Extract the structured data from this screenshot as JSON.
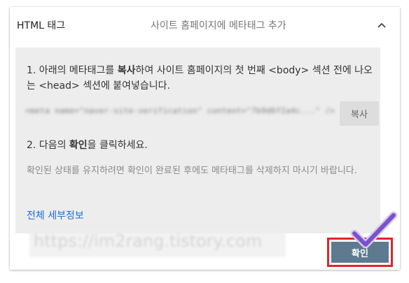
{
  "header": {
    "title": "HTML 태그",
    "subtitle": "사이트 홈페이지에 메타태그 추가"
  },
  "instructions": {
    "step1_prefix": "1. 아래의 메타태그를 ",
    "step1_bold": "복사",
    "step1_suffix": "하여 사이트 홈페이지의 첫 번째 <body> 섹션 전에 나오는 <head> 섹션에 붙여넣습니다.",
    "meta_code": "<meta name=\"naver-site-verification\" content=\"7b9d6f2a4c...\" />",
    "copy_button": "복사",
    "step2_prefix": "2. 다음의 ",
    "step2_bold": "확인",
    "step2_suffix": "을 클릭하세요.",
    "note": "확인된 상태를 유지하려면 확인이 완료된 후에도 메타태그를 삭제하지 마시기 바랍니다.",
    "details_link": "전체 세부정보"
  },
  "watermark": "https://im2rang.tistory.com",
  "confirm_button": "확인",
  "colors": {
    "panel_bg": "#ededed",
    "link": "#1a6fd6",
    "confirm_bg": "#5d7a8e",
    "highlight_border": "#e3242b",
    "check_mark": "#7b52c9"
  },
  "icons": {
    "collapse": "chevron-up-icon",
    "annotation": "check-mark-icon"
  }
}
